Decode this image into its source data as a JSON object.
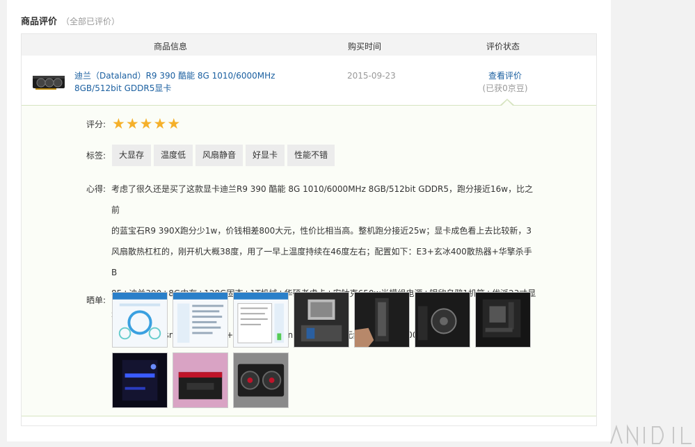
{
  "section": {
    "title": "商品评价",
    "subtitle": "（全部已评价）"
  },
  "table_headers": {
    "product_info": "商品信息",
    "purchase_time": "购买时间",
    "review_status": "评价状态"
  },
  "product": {
    "name_line1": "迪兰（Dataland）R9 390 酷能 8G 1010/6000MHz",
    "name_line2": "8GB/512bit GDDR5显卡",
    "purchase_date": "2015-09-23",
    "view_review_link": "查看评价",
    "points_note": "(已获0京豆)"
  },
  "review": {
    "score_label": "评分:",
    "rating": 5,
    "tags_label": "标签:",
    "tags": [
      "大显存",
      "温度低",
      "风扇静音",
      "好显卡",
      "性能不错"
    ],
    "experience_label": "心得:",
    "experience_lines": [
      "考虑了很久还是买了这款显卡迪兰R9 390 酷能 8G 1010/6000MHz 8GB/512bit GDDR5，跑分接近16w，比之前",
      "的蓝宝石R9 390X跑分少1w，价钱相差800大元，性价比相当高。整机跑分接近25w；显卡成色看上去比较新，3",
      "风扇散热杠杠的，刚开机大概38度，用了一早上温度持续在46度左右；配置如下：E3+玄冰400散热器+华擎杀手B",
      "85+迪兰390+8G内存+128G固态+1T机械+华硕老虎卡+安钛克650w半模组电源+银欣乌鸦1机箱+优派23寸显示器",
      "+技嘉Aivia Osmium机械键盘+技嘉Aivia Uranium 无延迟的无线鼠标+玄道600音箱"
    ],
    "photos_label": "晒单:",
    "photo_count": 10
  },
  "colors": {
    "link": "#1a5fa0",
    "star": "#f5b02a",
    "review_bg": "#fbfdf7",
    "review_border": "#d6e4c0"
  }
}
